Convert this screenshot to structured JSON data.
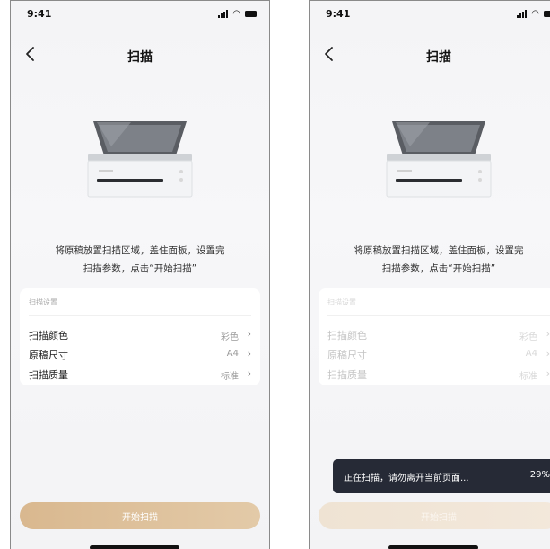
{
  "screens": [
    {
      "status_bar": {
        "time": "9:41"
      },
      "nav": {
        "title": "扫描"
      },
      "instruction": {
        "line1": "将原稿放置扫描区域，盖住面板，设置完",
        "line2": "扫描参数，点击“开始扫描”"
      },
      "settings": {
        "header": "扫描设置",
        "rows": [
          {
            "label": "扫描颜色",
            "value": "彩色"
          },
          {
            "label": "原稿尺寸",
            "value": "A4"
          },
          {
            "label": "扫描质量",
            "value": "标准"
          }
        ]
      },
      "start_button": {
        "label": "开始扫描"
      }
    },
    {
      "status_bar": {
        "time": "9:41"
      },
      "nav": {
        "title": "扫描"
      },
      "instruction": {
        "line1": "将原稿放置扫描区域，盖住面板，设置完",
        "line2": "扫描参数，点击“开始扫描”"
      },
      "settings": {
        "header": "扫描设置",
        "rows": [
          {
            "label": "扫描颜色",
            "value": "彩色"
          },
          {
            "label": "原稿尺寸",
            "value": "A4"
          },
          {
            "label": "扫描质量",
            "value": "标准"
          }
        ]
      },
      "toast": {
        "message": "正在扫描，请勿离开当前页面...",
        "progress": "29%"
      },
      "start_button": {
        "label": "开始扫描"
      }
    }
  ],
  "icons": [
    "back-chevron-icon",
    "signal-icon",
    "wifi-icon",
    "battery-icon",
    "chevron-right-icon",
    "printer-illustration"
  ],
  "colors": {
    "accent": "#d9b88f",
    "accent_disabled": "#efe3d3",
    "toast_bg": "#262a36"
  }
}
